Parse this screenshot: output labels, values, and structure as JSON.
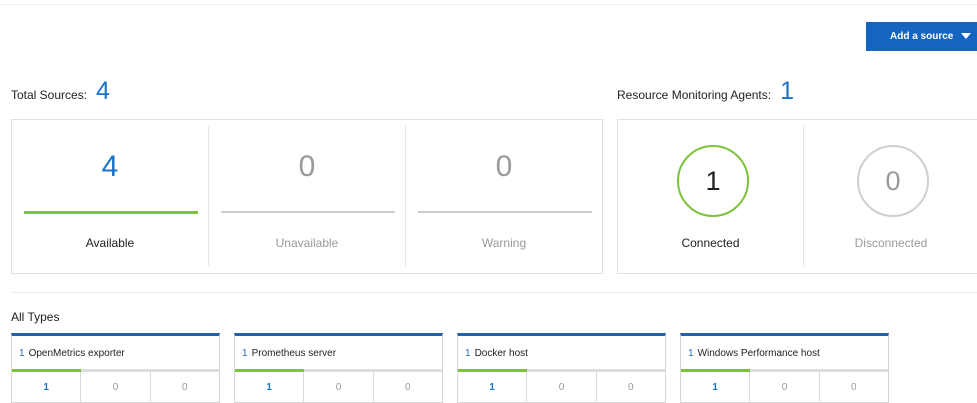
{
  "add_source": {
    "label": "Add a source",
    "icon": "caret-down-icon"
  },
  "total_sources": {
    "label": "Total Sources:",
    "value": "4"
  },
  "agents": {
    "label": "Resource Monitoring Agents:",
    "value": "1"
  },
  "source_status": [
    {
      "value": "4",
      "label": "Available"
    },
    {
      "value": "0",
      "label": "Unavailable"
    },
    {
      "value": "0",
      "label": "Warning"
    }
  ],
  "agent_status": [
    {
      "value": "1",
      "label": "Connected"
    },
    {
      "value": "0",
      "label": "Disconnected"
    }
  ],
  "types": {
    "title": "All Types",
    "cards": [
      {
        "count": "1",
        "name": "OpenMetrics exporter",
        "values": [
          "1",
          "0",
          "0"
        ]
      },
      {
        "count": "1",
        "name": "Prometheus server",
        "values": [
          "1",
          "0",
          "0"
        ]
      },
      {
        "count": "1",
        "name": "Docker host",
        "values": [
          "1",
          "0",
          "0"
        ]
      },
      {
        "count": "1",
        "name": "Windows Performance host",
        "values": [
          "1",
          "0",
          "0"
        ]
      }
    ]
  },
  "colors": {
    "accent": "#1a73c8",
    "button": "#1565c0",
    "ok": "#7cc33a",
    "muted": "#9a9a9a"
  }
}
